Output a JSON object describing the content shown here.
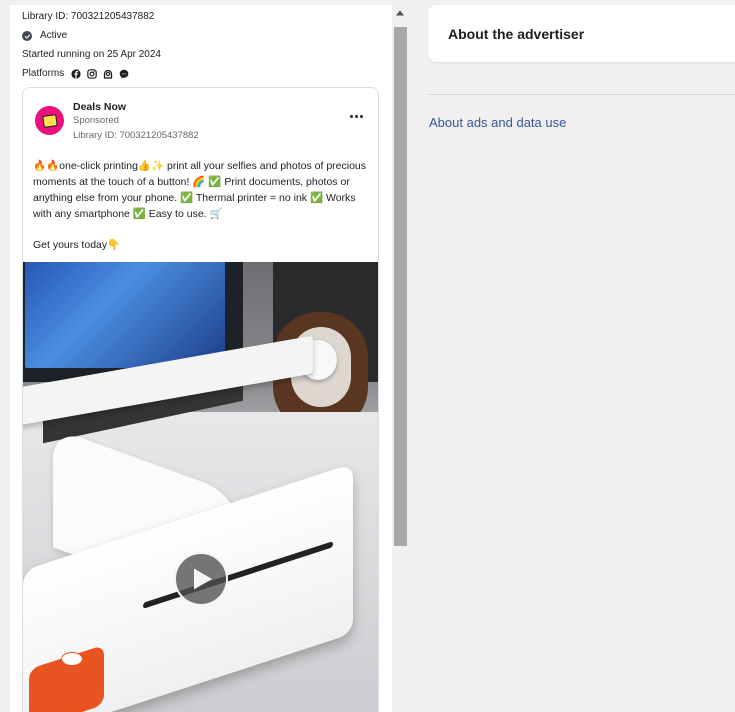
{
  "ad_meta": {
    "library_id": "Library ID: 700321205437882",
    "status": "Active",
    "started_running": "Started running on 25 Apr 2024",
    "platforms_label": "Platforms",
    "platform_icons": [
      "facebook-icon",
      "instagram-icon",
      "audience-network-icon",
      "messenger-icon"
    ]
  },
  "ad_card": {
    "advertiser_name": "Deals Now",
    "sponsored": "Sponsored",
    "library_id": "Library ID: 700321205437882",
    "body_text": "🔥🔥one-click printing👍✨ print all your selfies and photos of precious moments at the touch of a button! 🌈 ✅ Print documents, photos or anything else from your phone. ✅ Thermal printer = no ink ✅ Works with any smartphone ✅ Easy to use. 🛒",
    "cta_text": "Get yours today👇",
    "media": {
      "type": "video",
      "play_icon": "play-icon"
    },
    "brand_color": "#ec0f7e"
  },
  "right_panel": {
    "about_advertiser_title": "About the advertiser",
    "about_ads_link": "About ads and data use",
    "link_color": "#385898"
  }
}
